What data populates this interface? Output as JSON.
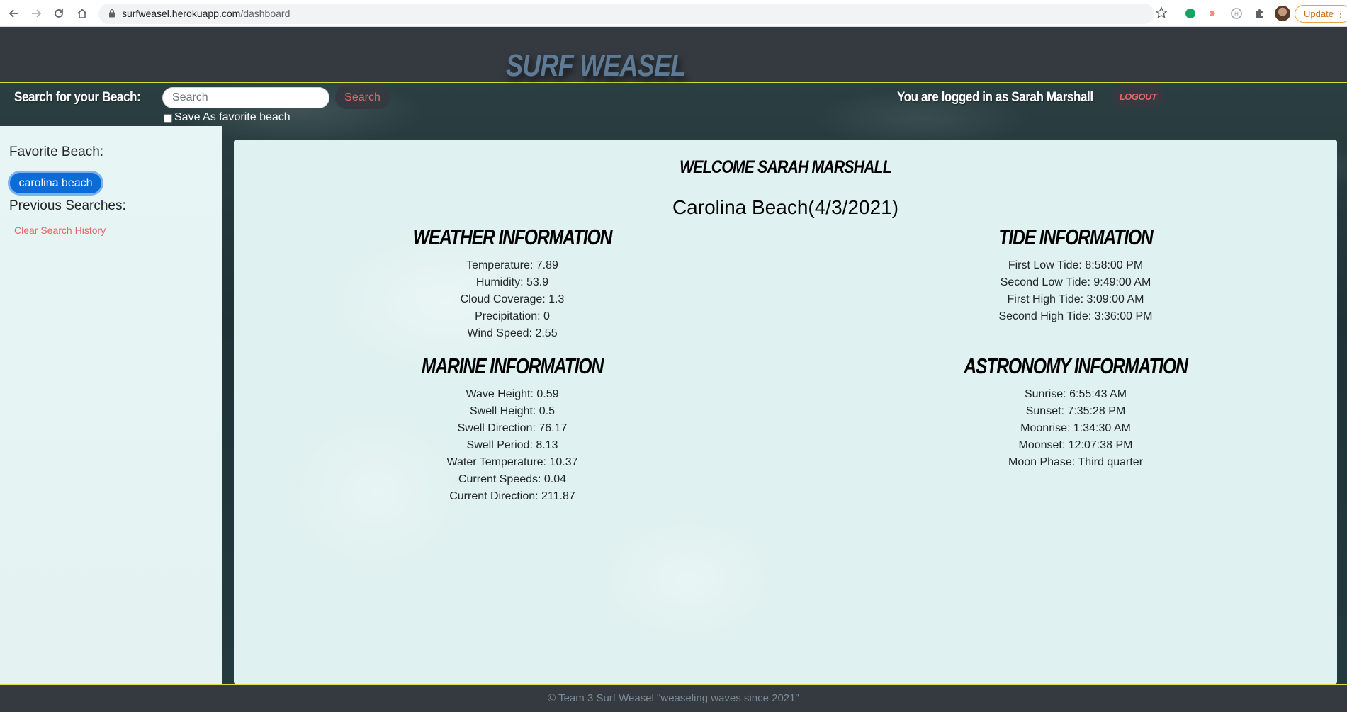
{
  "browser": {
    "url_host": "surfweasel.herokuapp.com",
    "url_path": "/dashboard",
    "update_label": "Update"
  },
  "header": {
    "brand": "Surf Weasel"
  },
  "search": {
    "label": "Search for your Beach:",
    "placeholder": "Search",
    "button_label": "Search",
    "favorite_checkbox_label": "Save As favorite beach"
  },
  "user": {
    "logged_in_text": "You are logged in as Sarah Marshall",
    "logout_label": "Logout"
  },
  "sidebar": {
    "favorite_heading": "Favorite Beach:",
    "favorite_beach": "carolina beach",
    "previous_heading": "Previous Searches:",
    "clear_history": "Clear Search History"
  },
  "main": {
    "welcome": "Welcome Sarah Marshall",
    "beach_title": "Carolina Beach(4/3/2021)",
    "weather": {
      "title": "Weather Information",
      "lines": [
        "Temperature: 7.89",
        "Humidity: 53.9",
        "Cloud Coverage: 1.3",
        "Precipitation: 0",
        "Wind Speed: 2.55"
      ]
    },
    "tide": {
      "title": "Tide Information",
      "lines": [
        "First Low Tide: 8:58:00 PM",
        "Second Low Tide: 9:49:00 AM",
        "First High Tide: 3:09:00 AM",
        "Second High Tide: 3:36:00 PM"
      ]
    },
    "marine": {
      "title": "Marine Information",
      "lines": [
        "Wave Height: 0.59",
        "Swell Height: 0.5",
        "Swell Direction: 76.17",
        "Swell Period: 8.13",
        "Water Temperature: 10.37",
        "Current Speeds: 0.04",
        "Current Direction: 211.87"
      ]
    },
    "astronomy": {
      "title": "Astronomy Information",
      "lines": [
        "Sunrise: 6:55:43 AM",
        "Sunset: 7:35:28 PM",
        "Moonrise: 1:34:30 AM",
        "Moonset: 12:07:38 PM",
        "Moon Phase: Third quarter"
      ]
    }
  },
  "footer": {
    "text": "© Team 3 Surf Weasel \"weaseling waves since 2021\""
  },
  "colors": {
    "header_bg": "#343a40",
    "accent_red": "#e2696b",
    "chip_blue": "#0b6cd8",
    "header_border": "#d5e03a",
    "panel_bg": "#dff1f0"
  }
}
